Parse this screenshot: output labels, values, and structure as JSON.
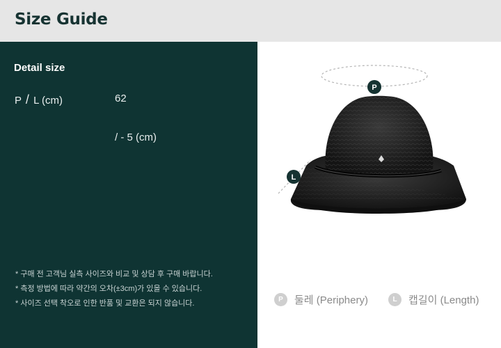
{
  "header": {
    "title": "Size Guide"
  },
  "detail": {
    "title": "Detail size",
    "label_p": "P",
    "label_slash": "/",
    "label_l": "L (cm)",
    "value": "62",
    "tolerance": "/ - 5 (cm)"
  },
  "notes": [
    "* 구매 전 고객님 실측 사이즈와 비교 및 상담 후 구매 바랍니다.",
    "* 측정 방법에 따라 약간의 오차(±3cm)가 있을 수 있습니다.",
    "* 사이즈 선택 착오로 인한 반품 및 교환은 되지 않습니다."
  ],
  "diagram": {
    "marker_p": "P",
    "marker_l": "L"
  },
  "legend": [
    {
      "badge": "P",
      "text": "둘레 (Periphery)"
    },
    {
      "badge": "L",
      "text": "캡길이 (Length)"
    }
  ],
  "colors": {
    "header_bg": "#e6e6e6",
    "panel_bg": "#0f3433",
    "title_text": "#163332",
    "marker": "#163332"
  }
}
